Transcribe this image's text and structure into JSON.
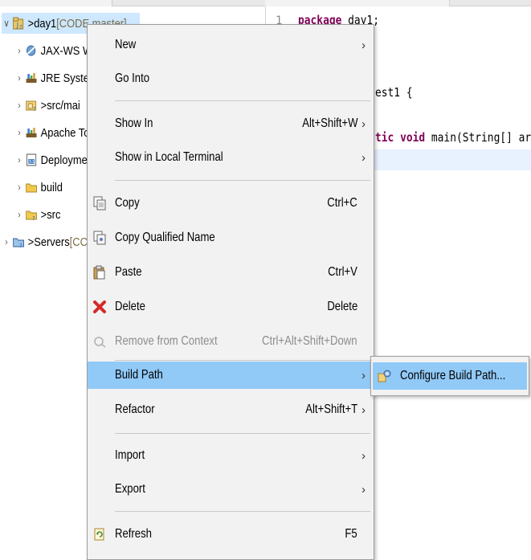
{
  "explorer": {
    "rows": [
      {
        "twisty": "∨",
        "prefix": "> ",
        "label": "day1",
        "suffix": " [CODE master]",
        "icon": "java-project-icon"
      },
      {
        "twisty": "›",
        "prefix": "",
        "label": "JAX-WS W",
        "suffix": "",
        "icon": "jaxws-web-services-icon"
      },
      {
        "twisty": "›",
        "prefix": "",
        "label": "JRE Syster",
        "suffix": "",
        "icon": "library-icon"
      },
      {
        "twisty": "›",
        "prefix": "> ",
        "label": "src/mai",
        "suffix": "",
        "icon": "source-folder-icon"
      },
      {
        "twisty": "›",
        "prefix": "",
        "label": "Apache To",
        "suffix": "",
        "icon": "library-icon"
      },
      {
        "twisty": "›",
        "prefix": "",
        "label": "Deployme",
        "suffix": "",
        "icon": "deployment-descriptor-icon"
      },
      {
        "twisty": "›",
        "prefix": "",
        "label": "build",
        "suffix": "",
        "icon": "folder-icon"
      },
      {
        "twisty": "›",
        "prefix": "> ",
        "label": "src",
        "suffix": "",
        "icon": "git-folder-icon"
      },
      {
        "twisty": "›",
        "prefix": "> ",
        "label": "Servers",
        "suffix": " [CC",
        "icon": "git-project-icon"
      }
    ]
  },
  "editor": {
    "lines": [
      {
        "num": "1",
        "pre": "",
        "kw": "package",
        "post": " day1;"
      },
      {
        "num": "",
        "pre": "",
        "kw": "",
        "post": "est1 {"
      },
      {
        "num": "",
        "pre": "",
        "kw": "tic void",
        "post": " main(String[] args)"
      }
    ]
  },
  "context_menu": {
    "items": [
      {
        "label": "New",
        "shortcut": "",
        "submenu": true,
        "icon": "",
        "disabled": false
      },
      {
        "label": "Go Into",
        "shortcut": "",
        "submenu": false,
        "icon": "",
        "disabled": false
      },
      {
        "label": "Show In",
        "shortcut": "Alt+Shift+W",
        "submenu": true,
        "icon": "",
        "disabled": false
      },
      {
        "label": "Show in Local Terminal",
        "shortcut": "",
        "submenu": true,
        "icon": "",
        "disabled": false
      },
      {
        "label": "Copy",
        "shortcut": "Ctrl+C",
        "submenu": false,
        "icon": "copy-icon",
        "disabled": false
      },
      {
        "label": "Copy Qualified Name",
        "shortcut": "",
        "submenu": false,
        "icon": "copy-qualified-name-icon",
        "disabled": false
      },
      {
        "label": "Paste",
        "shortcut": "Ctrl+V",
        "submenu": false,
        "icon": "paste-icon",
        "disabled": false
      },
      {
        "label": "Delete",
        "shortcut": "Delete",
        "submenu": false,
        "icon": "delete-icon",
        "disabled": false
      },
      {
        "label": "Remove from Context",
        "shortcut": "Ctrl+Alt+Shift+Down",
        "submenu": false,
        "icon": "remove-from-context-icon",
        "disabled": true
      },
      {
        "label": "Build Path",
        "shortcut": "",
        "submenu": true,
        "icon": "",
        "disabled": false,
        "active": true
      },
      {
        "label": "Refactor",
        "shortcut": "Alt+Shift+T",
        "submenu": true,
        "icon": "",
        "disabled": false
      },
      {
        "label": "Import",
        "shortcut": "",
        "submenu": true,
        "icon": "",
        "disabled": false
      },
      {
        "label": "Export",
        "shortcut": "",
        "submenu": true,
        "icon": "",
        "disabled": false
      },
      {
        "label": "Refresh",
        "shortcut": "F5",
        "submenu": false,
        "icon": "refresh-icon",
        "disabled": false
      }
    ],
    "submenu_arrow": "›"
  },
  "build_path_submenu": {
    "items": [
      {
        "label": "Configure Build Path...",
        "icon": "configure-build-path-icon"
      }
    ]
  },
  "colors": {
    "menu_background": "#f2f2f2",
    "menu_highlight": "#91c9f7",
    "disabled_text": "#8c8c8c",
    "java_keyword": "#7f0055"
  }
}
